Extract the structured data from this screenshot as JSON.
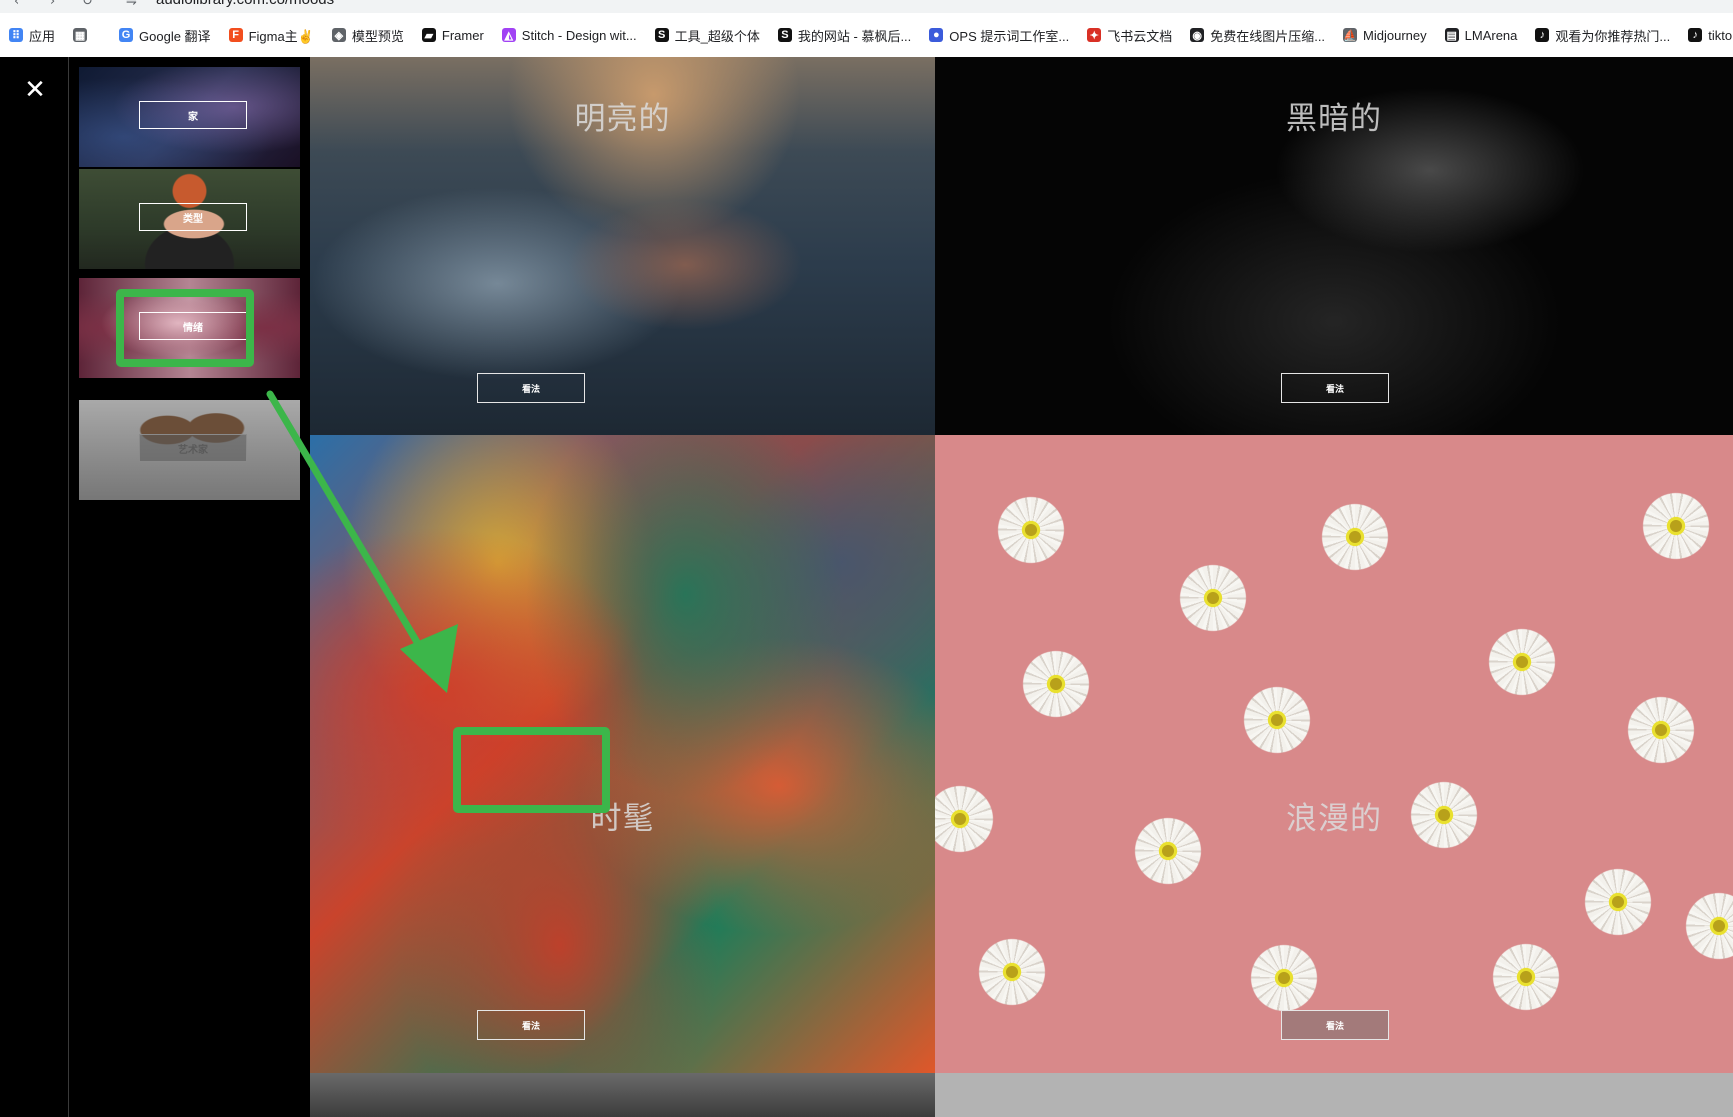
{
  "browser": {
    "url": "audiolibrary.com.co/moods",
    "bookmarks": [
      {
        "label": "应用",
        "icon": "apps-grid-icon",
        "color": "#4285f4"
      },
      {
        "label": "",
        "icon": "tab-groups-icon",
        "color": "#5f6368"
      },
      {
        "label": "Google 翻译",
        "icon": "google-translate-icon",
        "color": "#4285f4"
      },
      {
        "label": "Figma主✌",
        "icon": "figma-icon",
        "color": "#f24e1e"
      },
      {
        "label": "模型预览",
        "icon": "cube-icon",
        "color": "#5f6368"
      },
      {
        "label": "Framer",
        "icon": "framer-icon",
        "color": "#111111"
      },
      {
        "label": "Stitch - Design wit...",
        "icon": "stitch-icon",
        "color": "#a142f4"
      },
      {
        "label": "工具_超级个体",
        "icon": "s-logo-icon",
        "color": "#111111"
      },
      {
        "label": "我的网站 - 慕枫后...",
        "icon": "s-logo-icon",
        "color": "#111111"
      },
      {
        "label": "OPS 提示词工作室...",
        "icon": "ops-icon",
        "color": "#3b5bdb"
      },
      {
        "label": "飞书云文档",
        "icon": "feishu-icon",
        "color": "#d93025"
      },
      {
        "label": "免费在线图片压缩...",
        "icon": "compress-icon",
        "color": "#202124"
      },
      {
        "label": "Midjourney",
        "icon": "midjourney-icon",
        "color": "#5f6368"
      },
      {
        "label": "LMArena",
        "icon": "lmarena-icon",
        "color": "#202124"
      },
      {
        "label": "观看为你推荐热门...",
        "icon": "tiktok-icon",
        "color": "#111111"
      },
      {
        "label": "tiktok",
        "icon": "tiktok-icon",
        "color": "#111111"
      }
    ]
  },
  "sidebar": {
    "close_glyph": "✕",
    "items": [
      {
        "label": "家",
        "dim": false
      },
      {
        "label": "类型",
        "dim": false
      },
      {
        "label": "情绪",
        "dim": false
      },
      {
        "label": "艺术家",
        "dim": true
      }
    ]
  },
  "moods": [
    {
      "title": "明亮的",
      "button": "看法"
    },
    {
      "title": "黑暗的",
      "button": "看法"
    },
    {
      "title": "时髦",
      "button": "看法"
    },
    {
      "title": "浪漫的",
      "button": "看法"
    }
  ],
  "annotation_color": "#3cb64a"
}
